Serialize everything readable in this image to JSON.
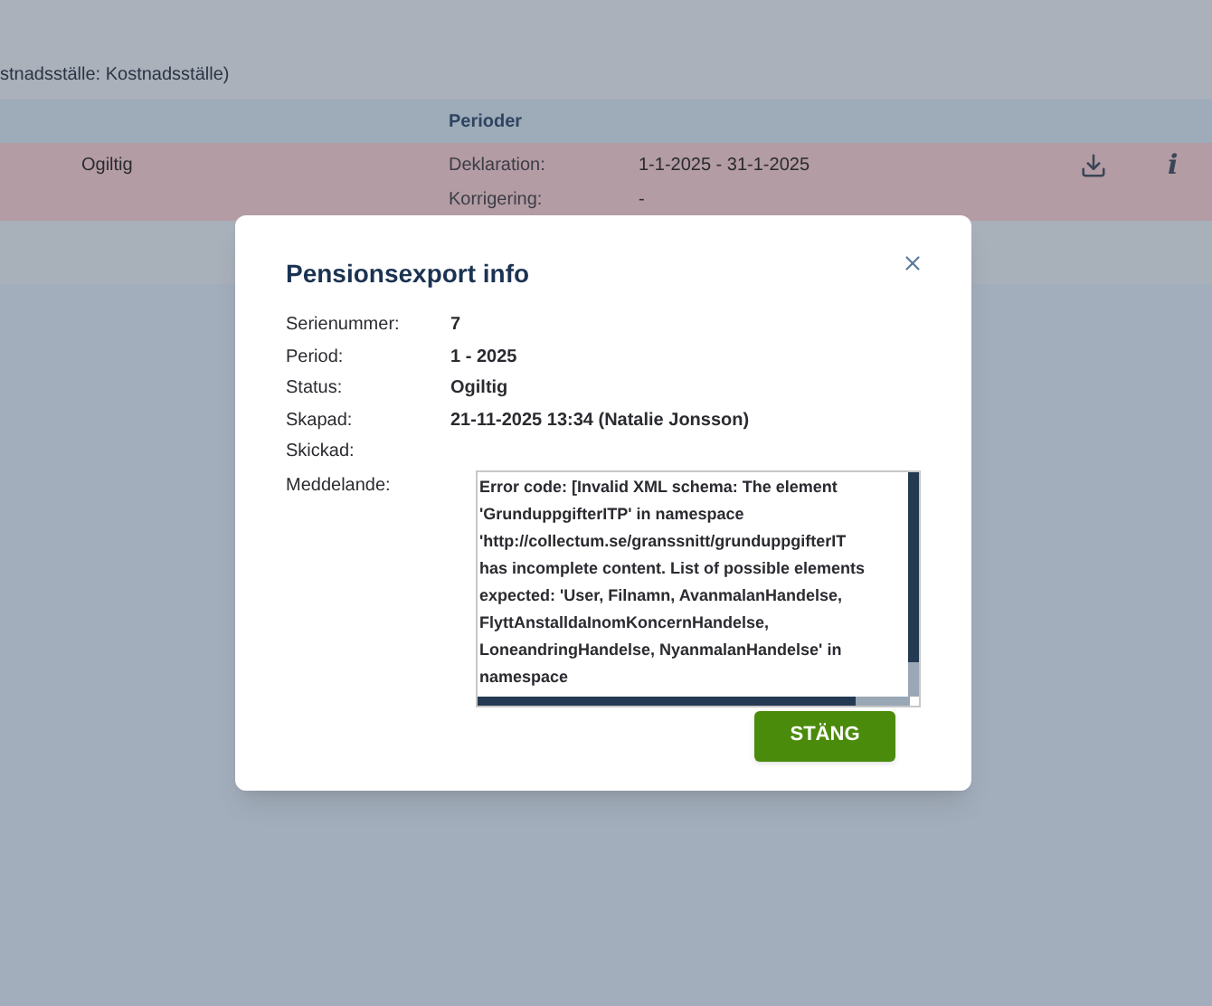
{
  "page": {
    "caption": "stnadsställe: Kostnadsställe)",
    "table": {
      "header": "Perioder",
      "row": {
        "status": "Ogiltig",
        "periods": [
          {
            "label": "Deklaration:",
            "value": "1-1-2025 - 31-1-2025"
          },
          {
            "label": "Korrigering:",
            "value": "-"
          }
        ],
        "info_glyph": "i"
      }
    }
  },
  "dialog": {
    "title": "Pensionsexport info",
    "fields": [
      {
        "label": "Serienummer:",
        "value": "7"
      },
      {
        "label": "Period:",
        "value": "1 - 2025"
      },
      {
        "label": "Status:",
        "value": "Ogiltig"
      },
      {
        "label": "Skapad:",
        "value": "21-11-2025 13:34 (Natalie Jonsson)"
      },
      {
        "label": "Skickad:"
      }
    ],
    "message": {
      "label": "Meddelande:",
      "lines": [
        "Error code: [Invalid XML schema: The element",
        "'GrunduppgifterITP' in namespace",
        "'http://collectum.se/granssnitt/grunduppgifterIT",
        "has incomplete content. List of possible elements",
        "expected: 'User, Filnamn, AvanmalanHandelse,",
        "FlyttAnstalldaInomKoncernHandelse,",
        "LoneandringHandelse, NyanmalanHandelse' in",
        "namespace"
      ]
    },
    "close_button": "STÄNG"
  }
}
